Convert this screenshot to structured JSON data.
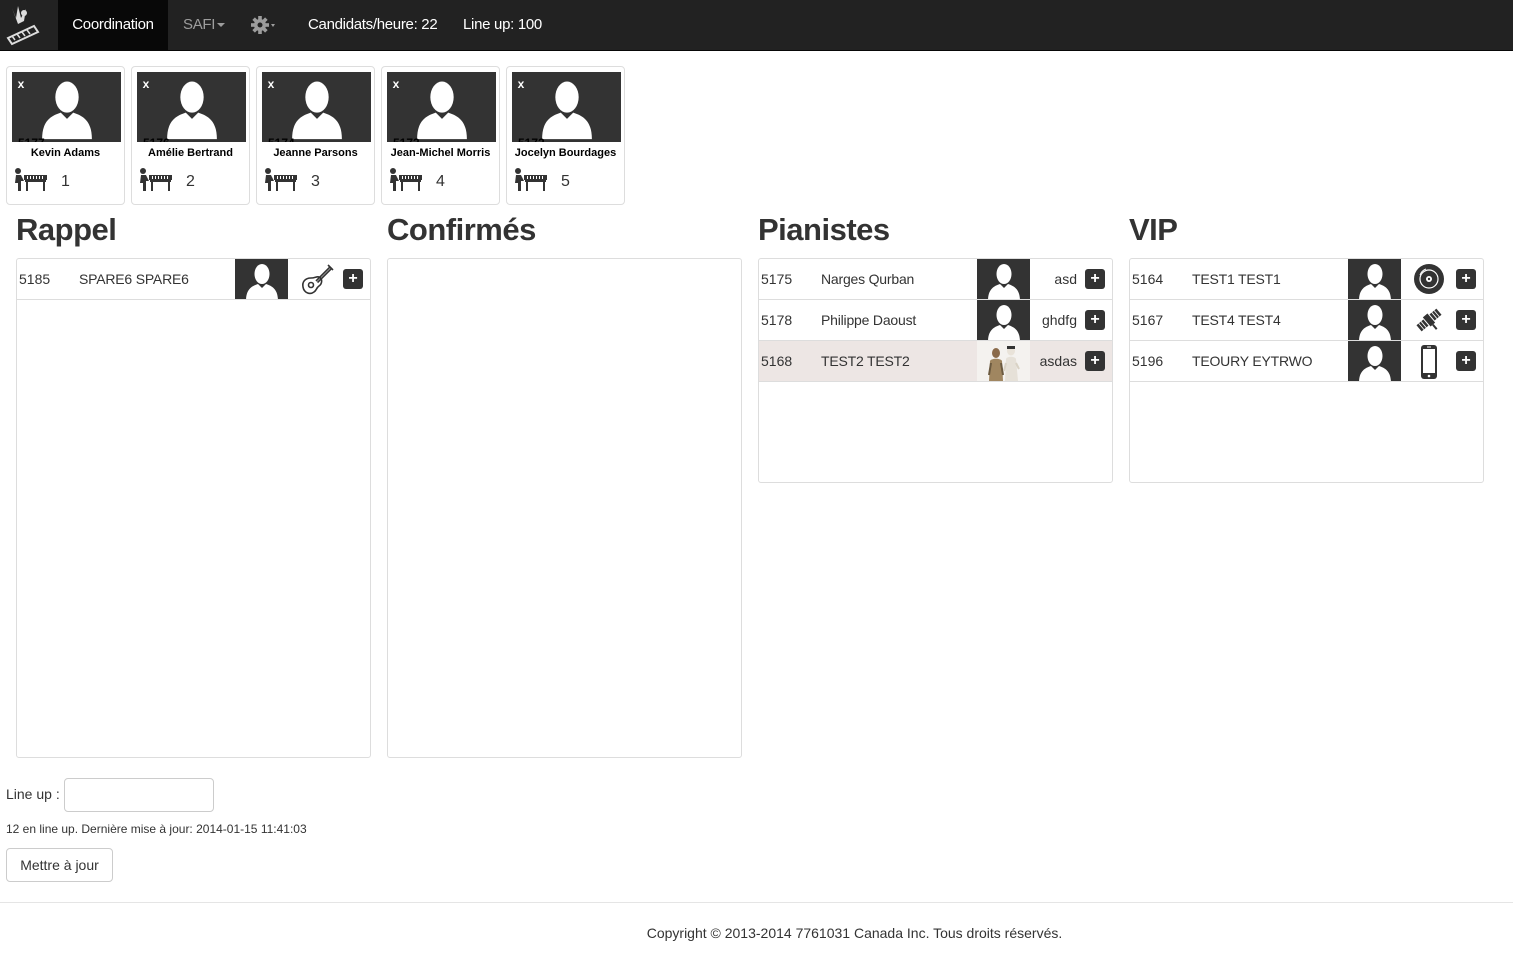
{
  "nav": {
    "coordination": "Coordination",
    "safi": "SAFI",
    "candidats": "Candidats/heure: 22",
    "lineup": "Line up: 100"
  },
  "queue": [
    {
      "id": "5177",
      "name": "Kevin Adams",
      "position": "1",
      "close": "x"
    },
    {
      "id": "5176",
      "name": "Amélie Bertrand",
      "position": "2",
      "close": "x"
    },
    {
      "id": "5174",
      "name": "Jeanne Parsons",
      "position": "3",
      "close": "x"
    },
    {
      "id": "5173",
      "name": "Jean-Michel Morris",
      "position": "4",
      "close": "x"
    },
    {
      "id": "5172",
      "name": "Jocelyn Bourdages",
      "position": "5",
      "close": "x"
    }
  ],
  "rappel": {
    "title": "Rappel",
    "rows": [
      {
        "id": "5185",
        "name": "SPARE6 SPARE6",
        "icon": "guitar-icon",
        "plus": "+"
      }
    ]
  },
  "confirmes": {
    "title": "Confirmés",
    "rows": []
  },
  "pianistes": {
    "title": "Pianistes",
    "rows": [
      {
        "id": "5175",
        "name": "Narges Qurban",
        "song": "asd",
        "plus": "+"
      },
      {
        "id": "5178",
        "name": "Philippe Daoust",
        "song": "ghdfg",
        "plus": "+"
      },
      {
        "id": "5168",
        "name": "TEST2 TEST2",
        "song": "asdas",
        "plus": "+",
        "highlight": true
      }
    ]
  },
  "vip": {
    "title": "VIP",
    "rows": [
      {
        "id": "5164",
        "name": "TEST1 TEST1",
        "icon": "disc-icon",
        "plus": "+"
      },
      {
        "id": "5167",
        "name": "TEST4 TEST4",
        "icon": "satellite-icon",
        "plus": "+"
      },
      {
        "id": "5196",
        "name": "TEOURY EYTRWO",
        "icon": "phone-icon",
        "plus": "+"
      }
    ]
  },
  "form": {
    "lineup_label": "Line up :",
    "lineup_value": "",
    "status": "12 en line up. Dernière mise à jour: 2014-01-15 11:41:03",
    "update_label": "Mettre à jour"
  },
  "footer": {
    "copyright": "Copyright © 2013-2014 7761031 Canada Inc. Tous droits réservés."
  },
  "colors": {
    "navbar": "#222222",
    "active_nav": "#080808",
    "highlight_row": "#ede6e4",
    "dark": "#333333"
  }
}
